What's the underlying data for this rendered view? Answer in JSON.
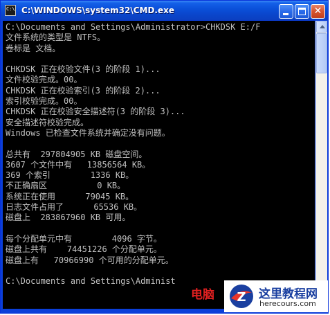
{
  "window": {
    "title": "C:\\WINDOWS\\system32\\CMD.exe"
  },
  "console": {
    "lines": [
      "C:\\Documents and Settings\\Administrator>CHKDSK E:/F",
      "文件系统的类型是 NTFS。",
      "卷标是 文档。",
      "",
      "CHKDSK 正在校验文件(3 的阶段 1)...",
      "文件校验完成。00。",
      "CHKDSK 正在校验索引(3 的阶段 2)...",
      "索引校验完成。00。",
      "CHKDSK 正在校验安全描述符(3 的阶段 3)...",
      "安全描述符校验完成。",
      "Windows 已检查文件系统并确定没有问题。",
      "",
      "总共有  297804905 KB 磁盘空间。",
      "3607 个文件中有   13856564 KB。",
      "369 个索引        1336 KB。",
      "不正确扇区          0 KB。",
      "系统正在使用      79045 KB。",
      "日志文件占用了      65536 KB。",
      "磁盘上  283867960 KB 可用。",
      "",
      "每个分配单元中有        4096 字节。",
      "磁盘上共有    74451226 个分配单元。",
      "磁盘上有   70966990 个可用的分配单元。",
      "",
      "C:\\Documents and Settings\\Administ"
    ]
  },
  "watermark": {
    "red_text": "电脑",
    "site_name": "这里教程网",
    "site_url": "herecours.com"
  },
  "colors": {
    "titlebar": "#0a4fd8",
    "console_bg": "#000000",
    "console_text": "#c0c0c0",
    "close_button": "#d6542e"
  },
  "icons": {
    "app": "cmd-icon",
    "minimize": "minimize-icon",
    "maximize": "maximize-icon",
    "close": "close-icon",
    "scroll_up": "arrow-up-icon",
    "scroll_down": "arrow-down-icon"
  }
}
